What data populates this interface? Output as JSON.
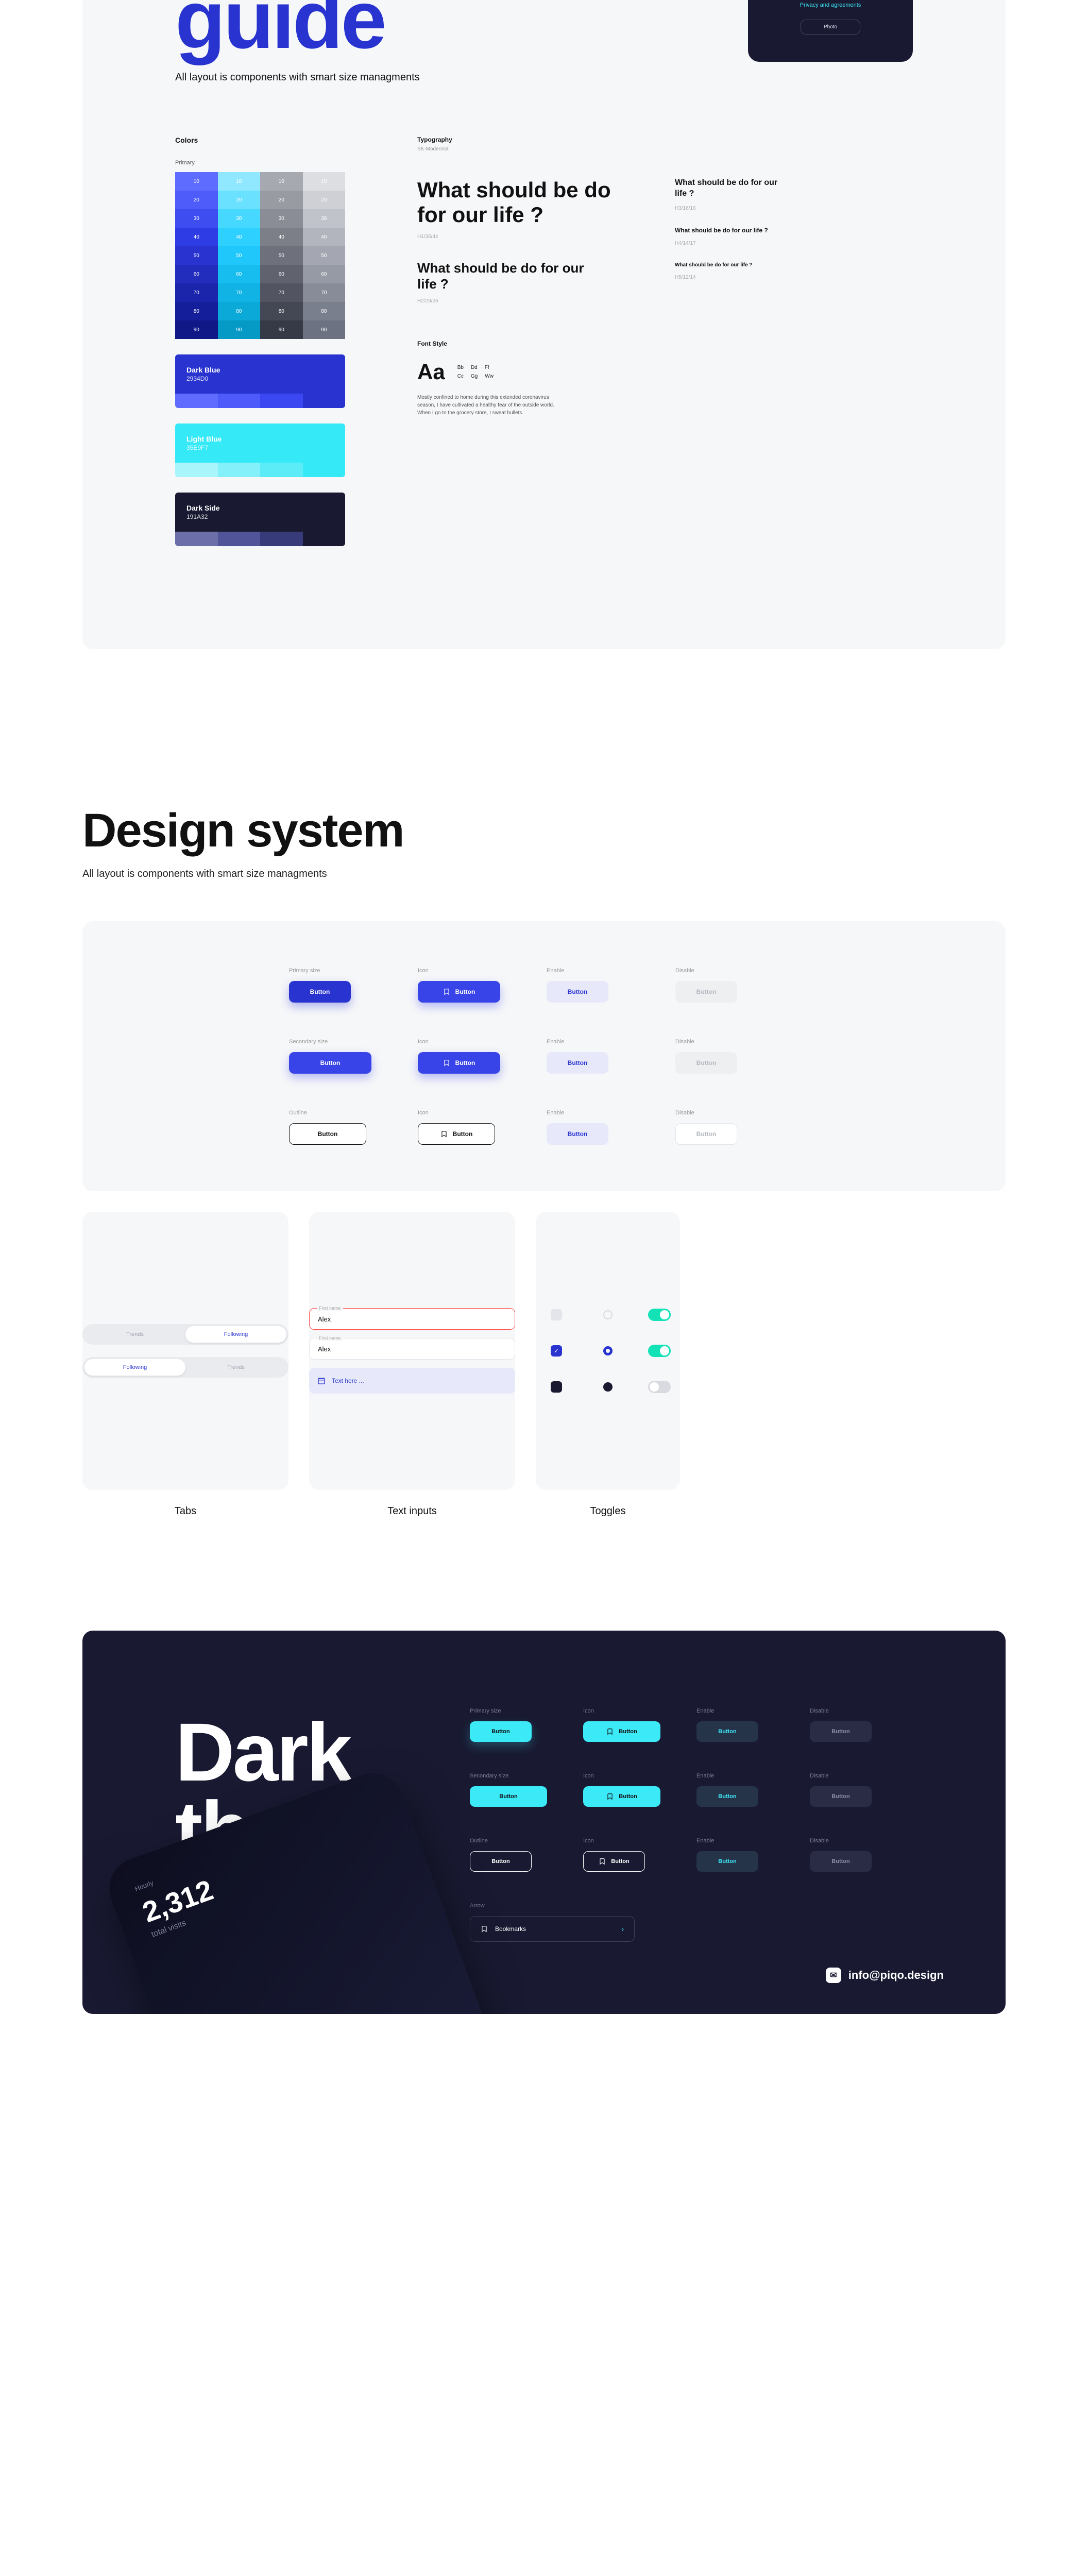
{
  "guide": {
    "title": "guide",
    "subtitle": "All layout is components with smart size managments",
    "mockup": {
      "link": "Privacy and agreements",
      "cta": "Photo"
    }
  },
  "colors": {
    "heading": "Colors",
    "primary_label": "Primary",
    "grid_labels": [
      "10",
      "10",
      "10",
      "10",
      "20",
      "20",
      "20",
      "20",
      "30",
      "30",
      "30",
      "30",
      "40",
      "40",
      "40",
      "40",
      "50",
      "50",
      "50",
      "50",
      "60",
      "60",
      "60",
      "60",
      "70",
      "70",
      "70",
      "70",
      "80",
      "80",
      "80",
      "80",
      "90",
      "90",
      "90",
      "90"
    ],
    "grid_fills": [
      "#5E6CFF",
      "#8FE8FF",
      "#A6A9AF",
      "#DCDEE2",
      "#4E5CFA",
      "#6AE1FF",
      "#989BA2",
      "#CED0D6",
      "#3E4DF0",
      "#46D8FF",
      "#8A8D95",
      "#C0C3CA",
      "#2E3CE6",
      "#2ED0FF",
      "#7C7F88",
      "#B2B5BD",
      "#2934D0",
      "#1FC7FB",
      "#6E717B",
      "#A4A7B1",
      "#222DBE",
      "#17BDEF",
      "#60636E",
      "#969AA5",
      "#1B25AC",
      "#10B3E4",
      "#525561",
      "#888C99",
      "#151E9A",
      "#0AA9D8",
      "#444854",
      "#7A7F8D",
      "#101888",
      "#0599C6",
      "#363A47",
      "#6C7281"
    ],
    "cards": [
      {
        "name": "Dark Blue",
        "hex": "2934D0",
        "fill": "#2934D0",
        "shades": [
          "#606BFF",
          "#4E5AFA",
          "#3B48F2",
          "#2934D0"
        ]
      },
      {
        "name": "Light Blue",
        "hex": "35E9F7",
        "fill": "#35E9F7",
        "shades": [
          "#A8F5FC",
          "#84F0F9",
          "#5BECF8",
          "#35E9F7"
        ]
      },
      {
        "name": "Dark Side",
        "hex": "191A32",
        "fill": "#191A32",
        "shades": [
          "#6B6EA8",
          "#515499",
          "#383B7A",
          "#191A32"
        ]
      }
    ]
  },
  "typography": {
    "heading": "Typography",
    "font": "SK-Modernist",
    "sample_text": "What should be do for our life ?",
    "metas": {
      "h1": "H1/36/44",
      "h2": "H2/29/26",
      "h3": "H3/16/16",
      "h4": "H4/14/17",
      "h5": "H5/12/14"
    },
    "font_style_heading": "Font Style",
    "aa": "Aa",
    "pairs_row1": [
      "Bb",
      "Dd",
      "Ff"
    ],
    "pairs_row2": [
      "Cc",
      "Gg",
      "Ww"
    ],
    "lorem": "Mostly confined to home during this extended coronavirus season, I have cultivated a healthy fear of the outside world. When I go to the grocery store, I sweat bullets."
  },
  "design": {
    "title": "Design system",
    "subtitle": "All layout is components with smart size managments",
    "labels": {
      "primary": "Primary size",
      "icon": "Icon",
      "enable": "Enable",
      "disable": "Disable",
      "secondary": "Secondary size",
      "outline": "Outline"
    },
    "button_text": "Button"
  },
  "tabs": {
    "caption": "Tabs",
    "group1": {
      "a": "Trends",
      "b": "Following"
    },
    "group2": {
      "a": "Following",
      "b": "Trends"
    }
  },
  "inputs": {
    "caption": "Text inputs",
    "field_label": "First name",
    "value": "Alex",
    "text_here": "Text here ..."
  },
  "toggles": {
    "caption": "Toggles"
  },
  "dark": {
    "title_line1": "Dark",
    "title_line2": "theme",
    "labels": {
      "primary": "Primary size",
      "icon": "Icon",
      "enable": "Enable",
      "disable": "Disable",
      "secondary": "Secondary size",
      "outline": "Outline",
      "arrow": "Arrow"
    },
    "button_text": "Button",
    "arrow_btn": "Bookmarks",
    "phone": {
      "hourly": "Hourly",
      "stat": "2,312",
      "stat_sub": "total visits"
    },
    "email": "info@piqo.design"
  }
}
